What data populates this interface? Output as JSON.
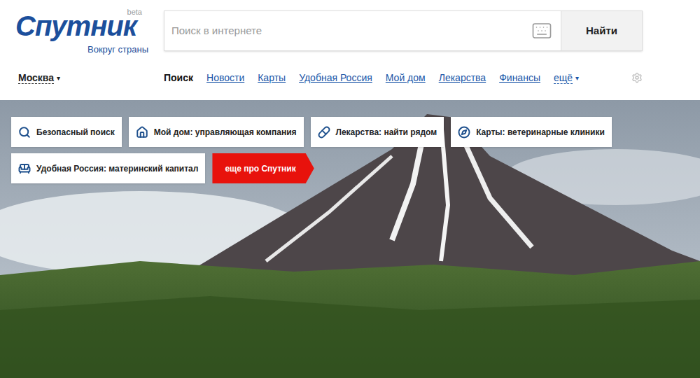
{
  "logo": {
    "title": "Спутник",
    "badge": "beta",
    "subtitle": "Вокруг страны"
  },
  "search": {
    "placeholder": "Поиск в интернете",
    "button": "Найти"
  },
  "region": {
    "label": "Москва",
    "arrow": "▾"
  },
  "nav": [
    {
      "label": "Поиск",
      "selected": true
    },
    {
      "label": "Новости",
      "selected": false
    },
    {
      "label": "Карты",
      "selected": false
    },
    {
      "label": "Удобная Россия",
      "selected": false
    },
    {
      "label": "Мой дом",
      "selected": false
    },
    {
      "label": "Лекарства",
      "selected": false
    },
    {
      "label": "Финансы",
      "selected": false
    }
  ],
  "more": {
    "label": "ещё",
    "arrow": "▾"
  },
  "cards": [
    {
      "label": "Безопасный поиск",
      "icon": "search"
    },
    {
      "label": "Мой дом: управляющая компания",
      "icon": "house"
    },
    {
      "label": "Лекарства: найти рядом",
      "icon": "pill"
    },
    {
      "label": "Карты: ветеринарные клиники",
      "icon": "compass"
    },
    {
      "label": "Удобная Россия: материнский капитал",
      "icon": "sofa"
    }
  ],
  "promo": {
    "label": "еще про Спутник"
  }
}
